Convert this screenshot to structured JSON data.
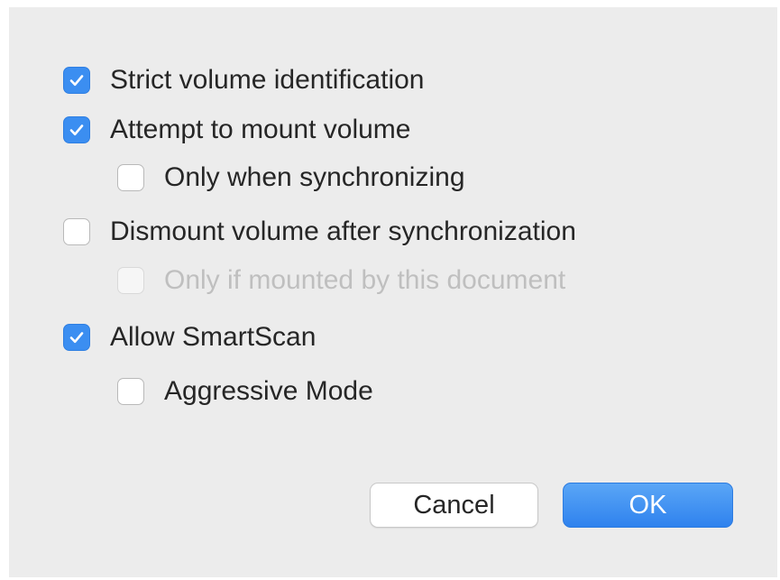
{
  "options": [
    {
      "label": "Strict volume identification",
      "checked": true,
      "enabled": true
    },
    {
      "label": "Attempt to mount volume",
      "checked": true,
      "enabled": true
    },
    {
      "label": "Only when synchronizing",
      "checked": false,
      "enabled": true
    },
    {
      "label": "Dismount volume after synchronization",
      "checked": false,
      "enabled": true
    },
    {
      "label": "Only if mounted by this document",
      "checked": false,
      "enabled": false
    },
    {
      "label": "Allow SmartScan",
      "checked": true,
      "enabled": true
    },
    {
      "label": "Aggressive Mode",
      "checked": false,
      "enabled": true
    }
  ],
  "buttons": {
    "cancel_label": "Cancel",
    "ok_label": "OK"
  },
  "colors": {
    "accent": "#3b8ef1",
    "dialog_background": "#ececec",
    "disabled_text": "#bfbfbf"
  },
  "icons": {
    "checkmark": "checkmark-icon"
  }
}
